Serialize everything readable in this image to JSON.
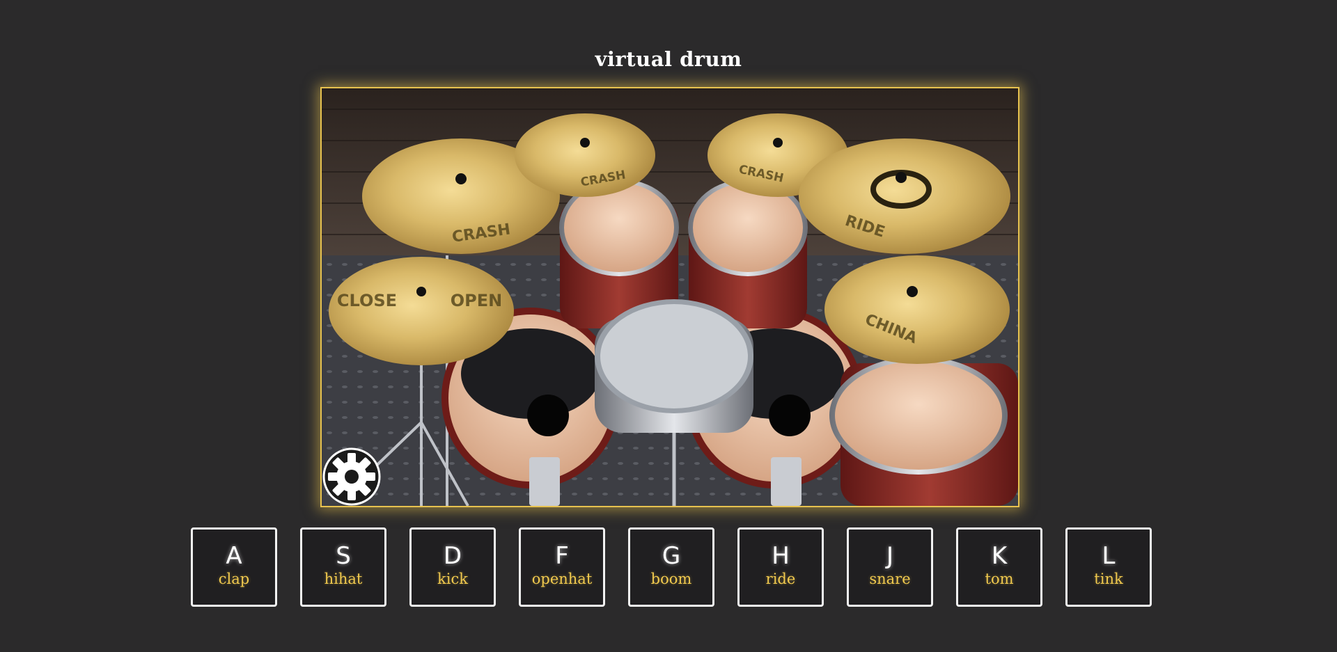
{
  "page": {
    "title": "virtual drum"
  },
  "drumkit": {
    "cymbal_labels": {
      "crash_left": "CRASH",
      "crash_top_left": "CRASH",
      "crash_top_right": "CRASH",
      "ride": "RIDE",
      "hihat_close": "CLOSE",
      "hihat_open": "OPEN",
      "china": "CHINA"
    },
    "colors": {
      "accent_glow": "#e7c24f",
      "cymbal_gold": "#d9b969",
      "shell_red": "#8c2a24",
      "drum_head": "#e9c3a6",
      "wall_wood": "#4a3f38",
      "floor_metal": "#3a3b40"
    },
    "settings_icon": "gear-icon"
  },
  "keys": [
    {
      "key": "A",
      "sound": "clap"
    },
    {
      "key": "S",
      "sound": "hihat"
    },
    {
      "key": "D",
      "sound": "kick"
    },
    {
      "key": "F",
      "sound": "openhat"
    },
    {
      "key": "G",
      "sound": "boom"
    },
    {
      "key": "H",
      "sound": "ride"
    },
    {
      "key": "J",
      "sound": "snare"
    },
    {
      "key": "K",
      "sound": "tom"
    },
    {
      "key": "L",
      "sound": "tink"
    }
  ]
}
